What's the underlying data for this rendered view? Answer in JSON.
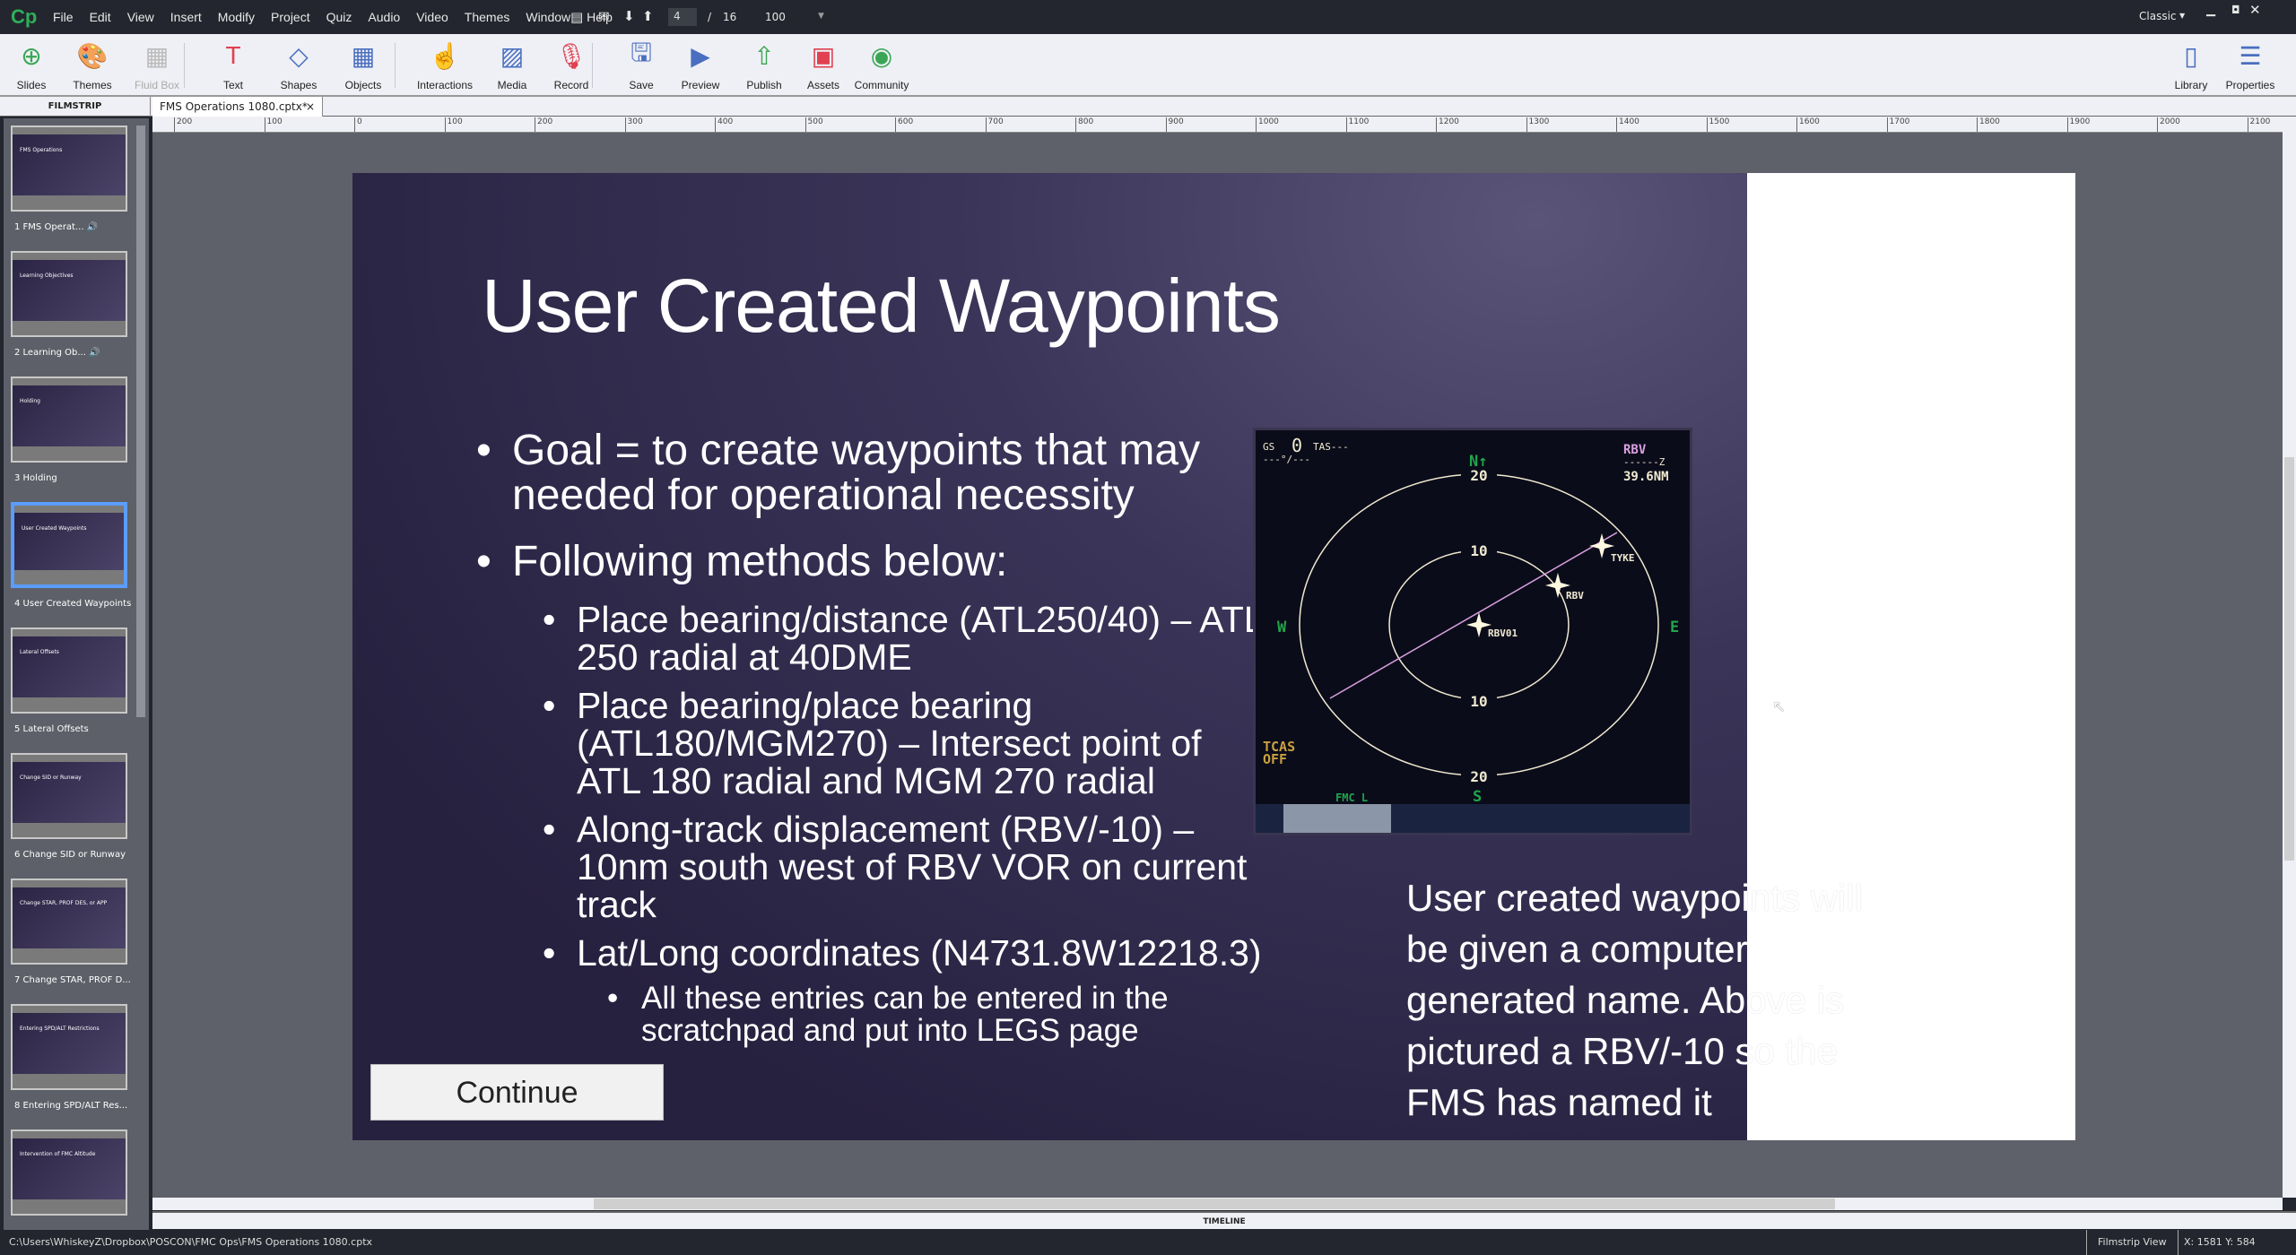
{
  "menubar": {
    "logo": "Cp",
    "menus": [
      "File",
      "Edit",
      "View",
      "Insert",
      "Modify",
      "Project",
      "Quiz",
      "Audio",
      "Video",
      "Themes",
      "Window",
      "Help"
    ],
    "current_slide": "4",
    "slide_sep": "/",
    "total_slides": "16",
    "zoom": "100",
    "workspace": "Classic"
  },
  "toolbar": {
    "items": [
      {
        "label": "Slides",
        "icon": "plus-circle-icon"
      },
      {
        "label": "Themes",
        "icon": "palette-icon"
      },
      {
        "label": "Fluid Box",
        "icon": "fluid-box-icon",
        "disabled": true
      },
      {
        "label": "Text",
        "icon": "text-icon"
      },
      {
        "label": "Shapes",
        "icon": "shapes-icon"
      },
      {
        "label": "Objects",
        "icon": "objects-icon"
      },
      {
        "label": "Interactions",
        "icon": "hand-pointer-icon"
      },
      {
        "label": "Media",
        "icon": "image-icon"
      },
      {
        "label": "Record",
        "icon": "microphone-icon"
      },
      {
        "label": "Save",
        "icon": "save-icon"
      },
      {
        "label": "Preview",
        "icon": "play-icon"
      },
      {
        "label": "Publish",
        "icon": "publish-icon"
      },
      {
        "label": "Assets",
        "icon": "assets-icon"
      },
      {
        "label": "Community",
        "icon": "community-icon"
      }
    ],
    "right": [
      {
        "label": "Library",
        "icon": "library-icon"
      },
      {
        "label": "Properties",
        "icon": "properties-icon"
      }
    ]
  },
  "filmstrip": {
    "header": "FILMSTRIP",
    "selected": 4,
    "slides": [
      {
        "label": "1 FMS Operat...",
        "title": "FMS Operations",
        "audio": true
      },
      {
        "label": "2 Learning Ob...",
        "title": "Learning Objectives",
        "audio": true
      },
      {
        "label": "3 Holding",
        "title": "Holding"
      },
      {
        "label": "4 User Created Waypoints",
        "title": "User Created Waypoints"
      },
      {
        "label": "5 Lateral Offsets",
        "title": "Lateral Offsets"
      },
      {
        "label": "6 Change SID or Runway",
        "title": "Change SID or Runway"
      },
      {
        "label": "7 Change STAR, PROF D...",
        "title": "Change STAR, PROF DES, or APP"
      },
      {
        "label": "8 Entering SPD/ALT Res...",
        "title": "Entering SPD/ALT Restrictions"
      },
      {
        "label": "",
        "title": "Intervention of FMC Altitude"
      }
    ]
  },
  "doc_tab": {
    "label": "FMS Operations 1080.cptx*",
    "close": "×"
  },
  "ruler": [
    "200",
    "100",
    "0",
    "100",
    "200",
    "300",
    "400",
    "500",
    "600",
    "700",
    "800",
    "900",
    "1000",
    "1100",
    "1200",
    "1300",
    "1400",
    "1500",
    "1600",
    "1700",
    "1800",
    "1900",
    "2000",
    "2100"
  ],
  "slide": {
    "title": "User Created Waypoints",
    "bullets": [
      {
        "level": 1,
        "text": "Goal = to create waypoints that may needed for operational necessity"
      },
      {
        "level": 1,
        "text": "Following methods below:"
      },
      {
        "level": 2,
        "text": "Place bearing/distance (ATL250/40) – ATL 250 radial at 40DME"
      },
      {
        "level": 2,
        "text": "Place bearing/place bearing (ATL180/MGM270) – Intersect point of ATL 180 radial and MGM 270 radial"
      },
      {
        "level": 2,
        "text": "Along-track displacement (RBV/-10) – 10nm south west of RBV VOR on current track"
      },
      {
        "level": 2,
        "text": "Lat/Long coordinates (N4731.8W12218.3)"
      },
      {
        "level": 3,
        "text": "All these entries can be entered in the scratchpad and put into LEGS page"
      }
    ],
    "side_text": "User created waypoints will be given a computer generated name. Above is pictured a RBV/-10 so the FMS has named it",
    "continue_label": "Continue",
    "nd": {
      "gs_label": "GS",
      "gs": "0",
      "tas": "TAS---",
      "wind": "---°/---",
      "north": "N↑",
      "rings": [
        "20",
        "10",
        "10",
        "20"
      ],
      "west": "W",
      "east": "E",
      "south": "S",
      "wpt": "RBV",
      "eta": "------Z",
      "dist": "39.6NM",
      "fixes": [
        "RBV01",
        "RBV",
        "TYKE"
      ],
      "tcas1": "TCAS",
      "tcas2": "OFF",
      "fmc": "FMC L",
      "colors": {
        "magenta": "#d8a0e0",
        "green": "#1fa64a",
        "amber": "#c8a040"
      }
    }
  },
  "timeline": "TIMELINE",
  "status": {
    "path": "C:\\Users\\WhiskeyZ\\Dropbox\\POSCON\\FMC Ops\\FMS Operations 1080.cptx",
    "view": "Filmstrip View",
    "coords": "X: 1581 Y: 584"
  }
}
